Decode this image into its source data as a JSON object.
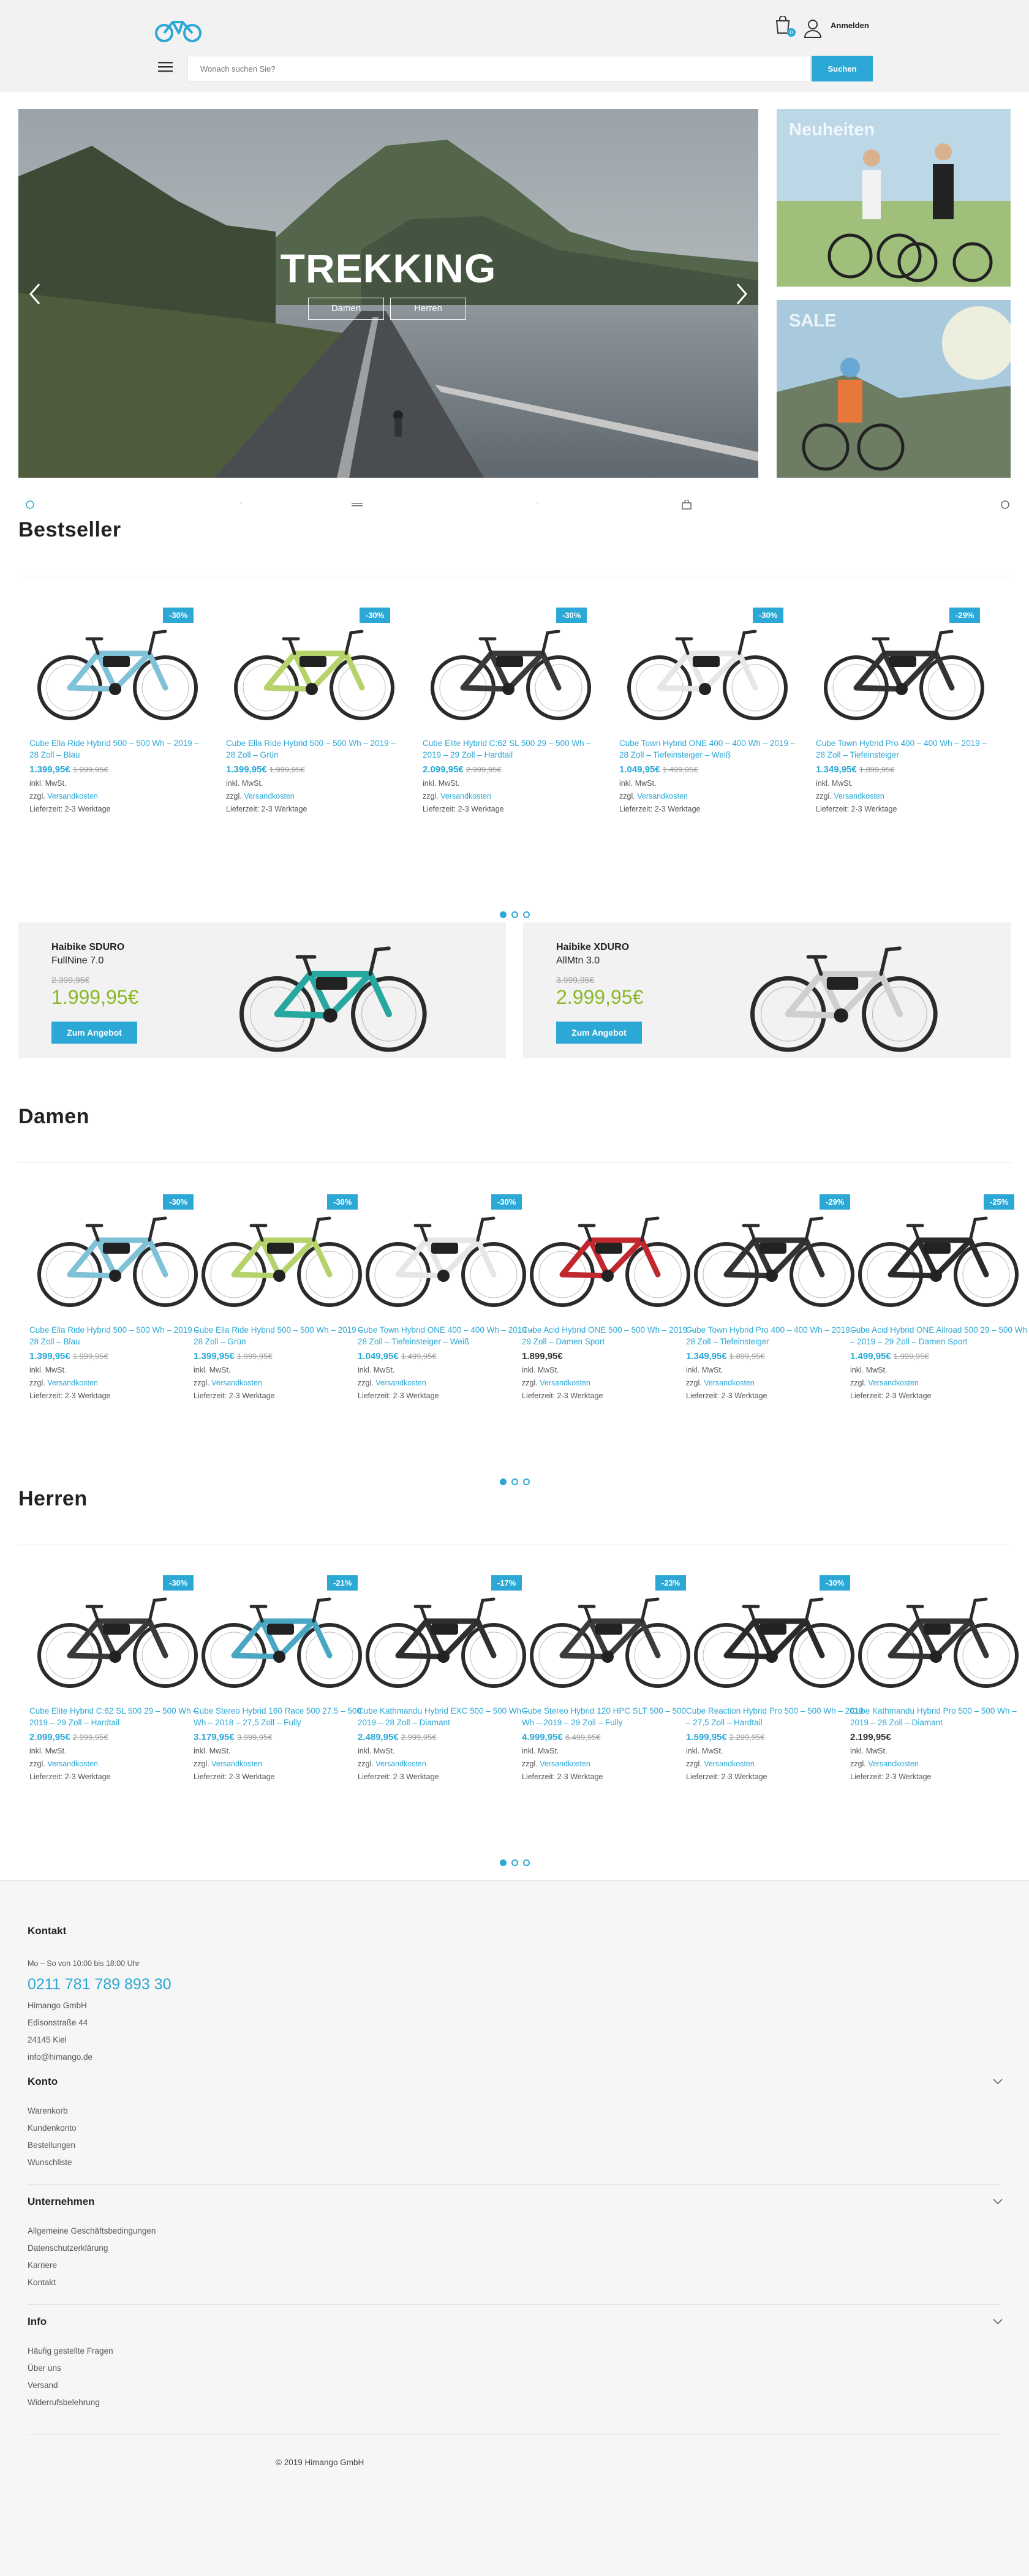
{
  "header": {
    "login_label": "Anmelden",
    "cart_count": "0",
    "search_placeholder": "Wonach suchen Sie?",
    "search_button": "Suchen"
  },
  "hero": {
    "title": "TREKKING",
    "btn_damen": "Damen",
    "btn_herren": "Herren"
  },
  "banners": {
    "neuheiten": "Neuheiten",
    "sale": "SALE"
  },
  "bestseller": {
    "title": "Bestseller",
    "products": [
      {
        "name": "Cube Ella Ride Hybrid 500 – 500 Wh – 2019 – 28 Zoll – Blau",
        "price": "1.399,95€",
        "old": "1.999,95€",
        "badge": "-30%",
        "color": "#7fc1d6"
      },
      {
        "name": "Cube Ella Ride Hybrid 500 – 500 Wh – 2019 – 28 Zoll – Grün",
        "price": "1.399,95€",
        "old": "1.999,95€",
        "badge": "-30%",
        "color": "#b5d36a"
      },
      {
        "name": "Cube Elite Hybrid C:62 SL 500 29 – 500 Wh – 2019 – 29 Zoll – Hardtail",
        "price": "2.099,95€",
        "old": "2.999,95€",
        "badge": "-30%",
        "color": "#3a3a3a"
      },
      {
        "name": "Cube Town Hybrid ONE 400 – 400 Wh – 2019 – 28 Zoll – Tiefeinsteiger – Weiß",
        "price": "1.049,95€",
        "old": "1.499,95€",
        "badge": "-30%",
        "color": "#e6e6e6"
      },
      {
        "name": "Cube Town Hybrid Pro 400 – 400 Wh – 2019 – 28 Zoll – Tiefeinsteiger",
        "price": "1.349,95€",
        "old": "1.899,95€",
        "badge": "-29%",
        "color": "#333333"
      }
    ]
  },
  "common": {
    "tax": "inkl. MwSt.",
    "shipping_prefix": "zzgl.",
    "shipping_link": "Versandkosten",
    "delivery": "Lieferzeit: 2-3 Werktage"
  },
  "promos": [
    {
      "brand": "Haibike SDURO",
      "model": "FullNine 7.0",
      "old": "2.399,95€",
      "price": "1.999,95€",
      "cta": "Zum Angebot",
      "color": "#26a7a0"
    },
    {
      "brand": "Haibike XDURO",
      "model": "AllMtn 3.0",
      "old": "3.999,95€",
      "price": "2.999,95€",
      "cta": "Zum Angebot",
      "color": "#cfcfcf"
    }
  ],
  "damen": {
    "title": "Damen",
    "products": [
      {
        "name": "Cube Ella Ride Hybrid 500 – 500 Wh – 2019 – 28 Zoll – Blau",
        "price": "1.399,95€",
        "old": "1.999,95€",
        "badge": "-30%",
        "color": "#7fc1d6"
      },
      {
        "name": "Cube Ella Ride Hybrid 500 – 500 Wh – 2019 – 28 Zoll – Grün",
        "price": "1.399,95€",
        "old": "1.999,95€",
        "badge": "-30%",
        "color": "#b5d36a"
      },
      {
        "name": "Cube Town Hybrid ONE 400 – 400 Wh – 2019 – 28 Zoll – Tiefeinsteiger – Weiß",
        "price": "1.049,95€",
        "old": "1.499,95€",
        "badge": "-30%",
        "color": "#e6e6e6"
      },
      {
        "name": "Cube Acid Hybrid ONE 500 – 500 Wh – 2019 – 29 Zoll – Damen Sport",
        "price": "1.899,95€",
        "old": "",
        "badge": "",
        "color": "#c0282d"
      },
      {
        "name": "Cube Town Hybrid Pro 400 – 400 Wh – 2019 – 28 Zoll – Tiefeinsteiger",
        "price": "1.349,95€",
        "old": "1.899,95€",
        "badge": "-29%",
        "color": "#333333"
      },
      {
        "name": "Cube Acid Hybrid ONE Allroad 500 29 – 500 Wh – 2019 – 29 Zoll – Damen Sport",
        "price": "1.499,95€",
        "old": "1.999,95€",
        "badge": "-25%",
        "color": "#2b2b2b"
      }
    ]
  },
  "herren": {
    "title": "Herren",
    "products": [
      {
        "name": "Cube Elite Hybrid C:62 SL 500 29 – 500 Wh – 2019 – 29 Zoll – Hardtail",
        "price": "2.099,95€",
        "old": "2.999,95€",
        "badge": "-30%",
        "color": "#3a3a3a"
      },
      {
        "name": "Cube Stereo Hybrid 160 Race 500 27.5 – 500 Wh – 2018 – 27,5 Zoll – Fully",
        "price": "3.179,95€",
        "old": "3.999,95€",
        "badge": "-21%",
        "color": "#4aa7c4"
      },
      {
        "name": "Cube Kathmandu Hybrid EXC 500 – 500 Wh – 2019 – 28 Zoll – Diamant",
        "price": "2.489,95€",
        "old": "2.999,95€",
        "badge": "-17%",
        "color": "#2f2f2f"
      },
      {
        "name": "Cube Stereo Hybrid 120 HPC SLT 500 – 500 Wh – 2019 – 29 Zoll – Fully",
        "price": "4.999,95€",
        "old": "6.499,95€",
        "badge": "-23%",
        "color": "#3c3c3c"
      },
      {
        "name": "Cube Reaction Hybrid Pro 500 – 500 Wh – 2019 – 27,5 Zoll – Hardtail",
        "price": "1.599,95€",
        "old": "2.299,95€",
        "badge": "-30%",
        "color": "#2a2a2a"
      },
      {
        "name": "Cube Kathmandu Hybrid Pro 500 – 500 Wh – 2019 – 28 Zoll – Diamant",
        "price": "2.199,95€",
        "old": "",
        "badge": "",
        "color": "#363636"
      }
    ]
  },
  "footer": {
    "kontakt_title": "Kontakt",
    "hours": "Mo – So von 10:00 bis 18:00 Uhr",
    "phone": "0211 781 789 893 30",
    "company": "Himango GmbH",
    "street": "Edisonstraße 44",
    "city": "24145 Kiel",
    "email": "info@himango.de",
    "konto_title": "Konto",
    "konto_links": [
      "Warenkorb",
      "Kundenkonto",
      "Bestellungen",
      "Wunschliste"
    ],
    "unternehmen_title": "Unternehmen",
    "unternehmen_links": [
      "Allgemeine Geschäftsbedingungen",
      "Datenschutzerklärung",
      "Karriere",
      "Kontakt"
    ],
    "info_title": "Info",
    "info_links": [
      "Häufig gestellte Fragen",
      "Über uns",
      "Versand",
      "Widerrufsbelehrung"
    ],
    "copyright": "© 2019 Himango GmbH"
  }
}
